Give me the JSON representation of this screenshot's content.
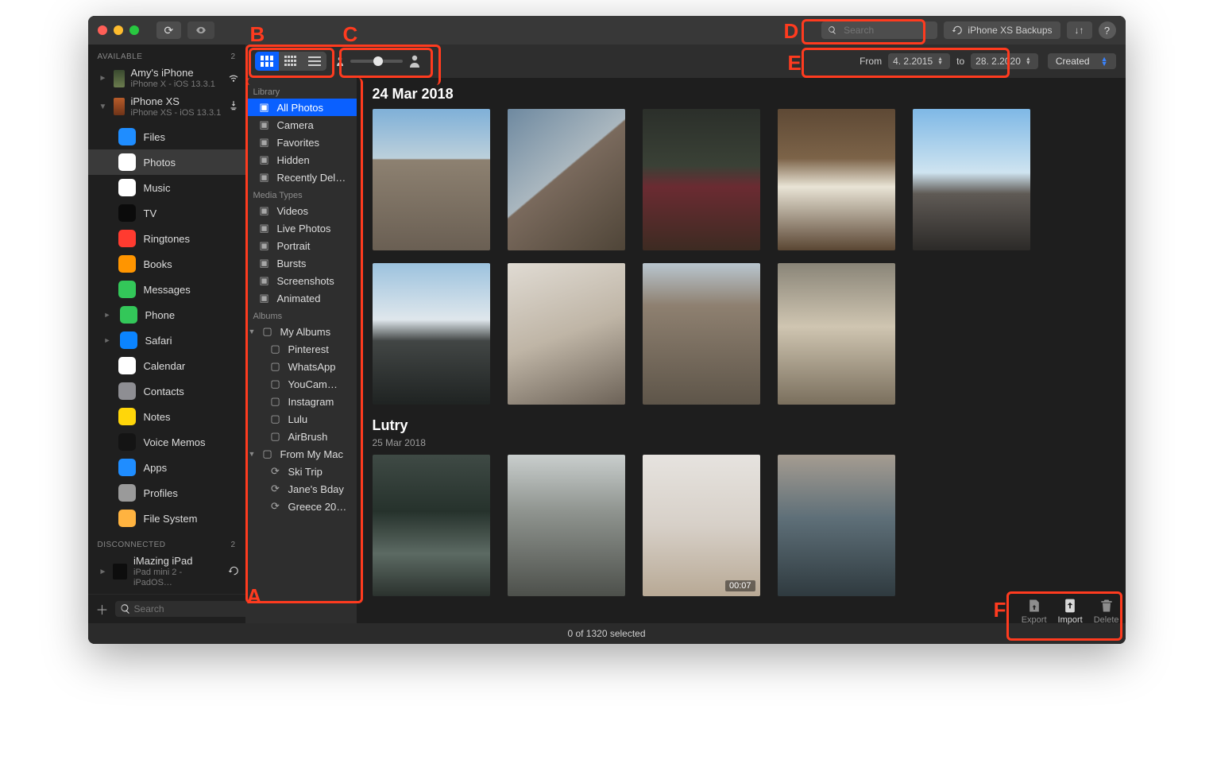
{
  "titlebar": {
    "search_placeholder": "Search",
    "backups_label": "iPhone XS Backups"
  },
  "sidebar": {
    "available_label": "AVAILABLE",
    "available_count": "2",
    "devices": [
      {
        "name": "Amy's iPhone",
        "sub": "iPhone X - iOS 13.3.1",
        "conn": "wifi"
      },
      {
        "name": "iPhone XS",
        "sub": "iPhone XS - iOS 13.3.1",
        "conn": "usb"
      }
    ],
    "apps": [
      {
        "label": "Files",
        "k": "blue"
      },
      {
        "label": "Photos",
        "k": "photos",
        "sel": true
      },
      {
        "label": "Music",
        "k": "music"
      },
      {
        "label": "TV",
        "k": "tv"
      },
      {
        "label": "Ringtones",
        "k": "red"
      },
      {
        "label": "Books",
        "k": "orange"
      },
      {
        "label": "Messages",
        "k": "green"
      },
      {
        "label": "Phone",
        "k": "green",
        "chev": true
      },
      {
        "label": "Safari",
        "k": "saf",
        "chev": true
      },
      {
        "label": "Calendar",
        "k": "cal"
      },
      {
        "label": "Contacts",
        "k": "gray"
      },
      {
        "label": "Notes",
        "k": "yellow"
      },
      {
        "label": "Voice Memos",
        "k": "vm"
      },
      {
        "label": "Apps",
        "k": "store"
      },
      {
        "label": "Profiles",
        "k": "prof"
      },
      {
        "label": "File System",
        "k": "fs"
      }
    ],
    "disconnected_label": "DISCONNECTED",
    "disconnected_count": "2",
    "disconnected_devices": [
      {
        "name": "iMazing iPad",
        "sub": "iPad mini 2 - iPadOS…"
      }
    ],
    "search_placeholder": "Search"
  },
  "toolbar": {
    "from_label": "From",
    "from_value": "4.  2.2015",
    "to_label": "to",
    "to_value": "28.  2.2020",
    "sort_label": "Created"
  },
  "library": {
    "library_head": "Library",
    "items": [
      {
        "label": "All Photos",
        "sel": true,
        "icon": "image"
      },
      {
        "label": "Camera",
        "icon": "camera"
      },
      {
        "label": "Favorites",
        "icon": "heart"
      },
      {
        "label": "Hidden",
        "icon": "hidden"
      },
      {
        "label": "Recently Del…",
        "icon": "trash"
      }
    ],
    "media_head": "Media Types",
    "media": [
      {
        "label": "Videos"
      },
      {
        "label": "Live Photos"
      },
      {
        "label": "Portrait"
      },
      {
        "label": "Bursts"
      },
      {
        "label": "Screenshots"
      },
      {
        "label": "Animated"
      }
    ],
    "albums_head": "Albums",
    "my_albums": "My Albums",
    "albums": [
      "Pinterest",
      "WhatsApp",
      "YouCam…",
      "Instagram",
      "Lulu",
      "AirBrush"
    ],
    "from_mac": "From My Mac",
    "mac_albums": [
      "Ski Trip",
      "Jane's Bday",
      "Greece 20…"
    ]
  },
  "sections": [
    {
      "title": "24 Mar 2018"
    },
    {
      "title": "Lutry",
      "sub": "25 Mar 2018"
    }
  ],
  "video_badge": "00:07",
  "footer": {
    "status": "0 of 1320 selected",
    "export": "Export",
    "import": "Import",
    "delete": "Delete"
  },
  "annots": {
    "A": "A",
    "B": "B",
    "C": "C",
    "D": "D",
    "E": "E",
    "F": "F"
  }
}
